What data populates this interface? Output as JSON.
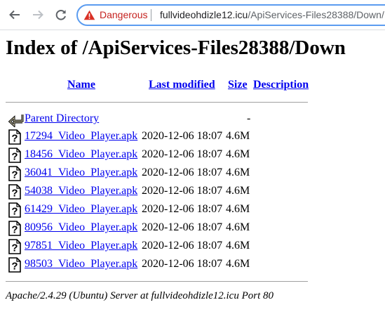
{
  "browser": {
    "security_label": "Dangerous",
    "url_host": "fullvideohdizle12.icu",
    "url_path": "/ApiServices-Files28388/Down/"
  },
  "page": {
    "title": "Index of /ApiServices-Files28388/Down",
    "columns": {
      "name": "Name",
      "last_modified": "Last modified",
      "size": "Size",
      "description": "Description"
    },
    "parent": {
      "label": "Parent Directory",
      "size": "-"
    },
    "files": [
      {
        "name": "17294_Video_Player.apk",
        "modified": "2020-12-06 18:07",
        "size": "4.6M"
      },
      {
        "name": "18456_Video_Player.apk",
        "modified": "2020-12-06 18:07",
        "size": "4.6M"
      },
      {
        "name": "36041_Video_Player.apk",
        "modified": "2020-12-06 18:07",
        "size": "4.6M"
      },
      {
        "name": "54038_Video_Player.apk",
        "modified": "2020-12-06 18:07",
        "size": "4.6M"
      },
      {
        "name": "61429_Video_Player.apk",
        "modified": "2020-12-06 18:07",
        "size": "4.6M"
      },
      {
        "name": "80956_Video_Player.apk",
        "modified": "2020-12-06 18:07",
        "size": "4.6M"
      },
      {
        "name": "97851_Video_Player.apk",
        "modified": "2020-12-06 18:07",
        "size": "4.6M"
      },
      {
        "name": "98503_Video_Player.apk",
        "modified": "2020-12-06 18:07",
        "size": "4.6M"
      }
    ],
    "footer": "Apache/2.4.29 (Ubuntu) Server at fullvideohdizle12.icu Port 80"
  }
}
